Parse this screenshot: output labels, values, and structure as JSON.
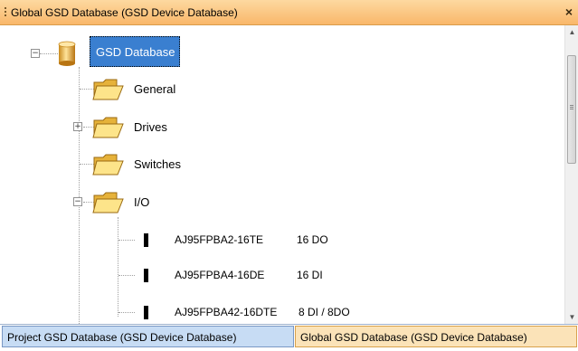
{
  "window": {
    "title": "Global GSD Database (GSD Device Database)",
    "close_glyph": "×"
  },
  "tree": {
    "root": {
      "label": "GSD Database",
      "icon": "database-icon",
      "expander": "⊟"
    },
    "folders": [
      {
        "label": "General"
      },
      {
        "label": "Drives",
        "expander": "+"
      },
      {
        "label": "Switches"
      },
      {
        "label": "I/O",
        "expander": "−"
      }
    ],
    "devices": [
      {
        "name": "AJ95FPBA2-16TE",
        "type": "16 DO"
      },
      {
        "name": "AJ95FPBA4-16DE",
        "type": "16 DI"
      },
      {
        "name": "AJ95FPBA42-16DTE",
        "type": "8 DI / 8DO"
      }
    ]
  },
  "tabs": [
    {
      "label": "Project GSD Database (GSD Device Database)"
    },
    {
      "label": "Global GSD Database (GSD Device Database)"
    }
  ],
  "colors": {
    "titlebar": "#f9b76a",
    "selection": "#3a7fd0",
    "tab_project": "#c7dcf4",
    "tab_global": "#fbe3b8"
  }
}
